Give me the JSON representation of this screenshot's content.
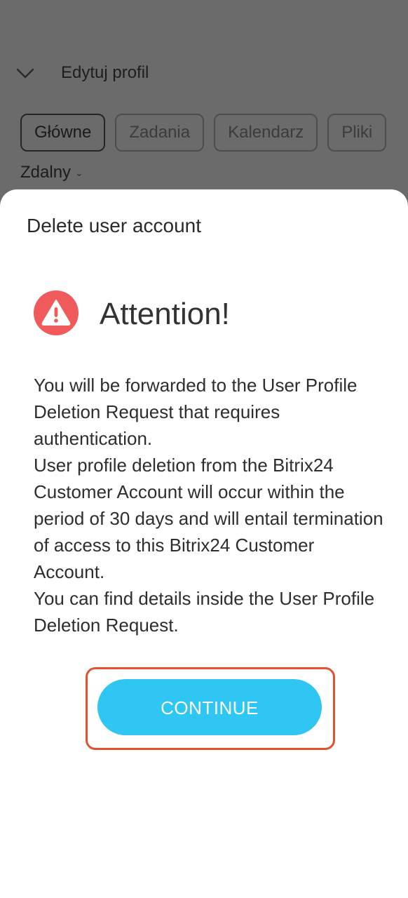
{
  "background": {
    "header_title": "Edytuj profil",
    "tabs": [
      {
        "label": "Główne"
      },
      {
        "label": "Zadania"
      },
      {
        "label": "Kalendarz"
      },
      {
        "label": "Pliki"
      }
    ],
    "status": "Zdalny"
  },
  "sheet": {
    "title": "Delete user account",
    "attention": "Attention!",
    "message": [
      "You will be forwarded to the User Profile Deletion Request that requires authentication.",
      "User profile deletion from the Bitrix24 Customer Account will occur within the period of 30 days and will entail termination of access to this Bitrix24 Customer Account.",
      "You can find details inside the User Profile Deletion Request."
    ],
    "continue_label": "CONTINUE"
  },
  "colors": {
    "overlay": "#6b6b6b",
    "warning": "#f05a5a",
    "button": "#2fc6f4",
    "highlight": "#e0532f"
  },
  "icons": {
    "back": "chevron-down-icon",
    "warning": "warning-triangle-icon",
    "dropdown": "caret-down-icon"
  }
}
